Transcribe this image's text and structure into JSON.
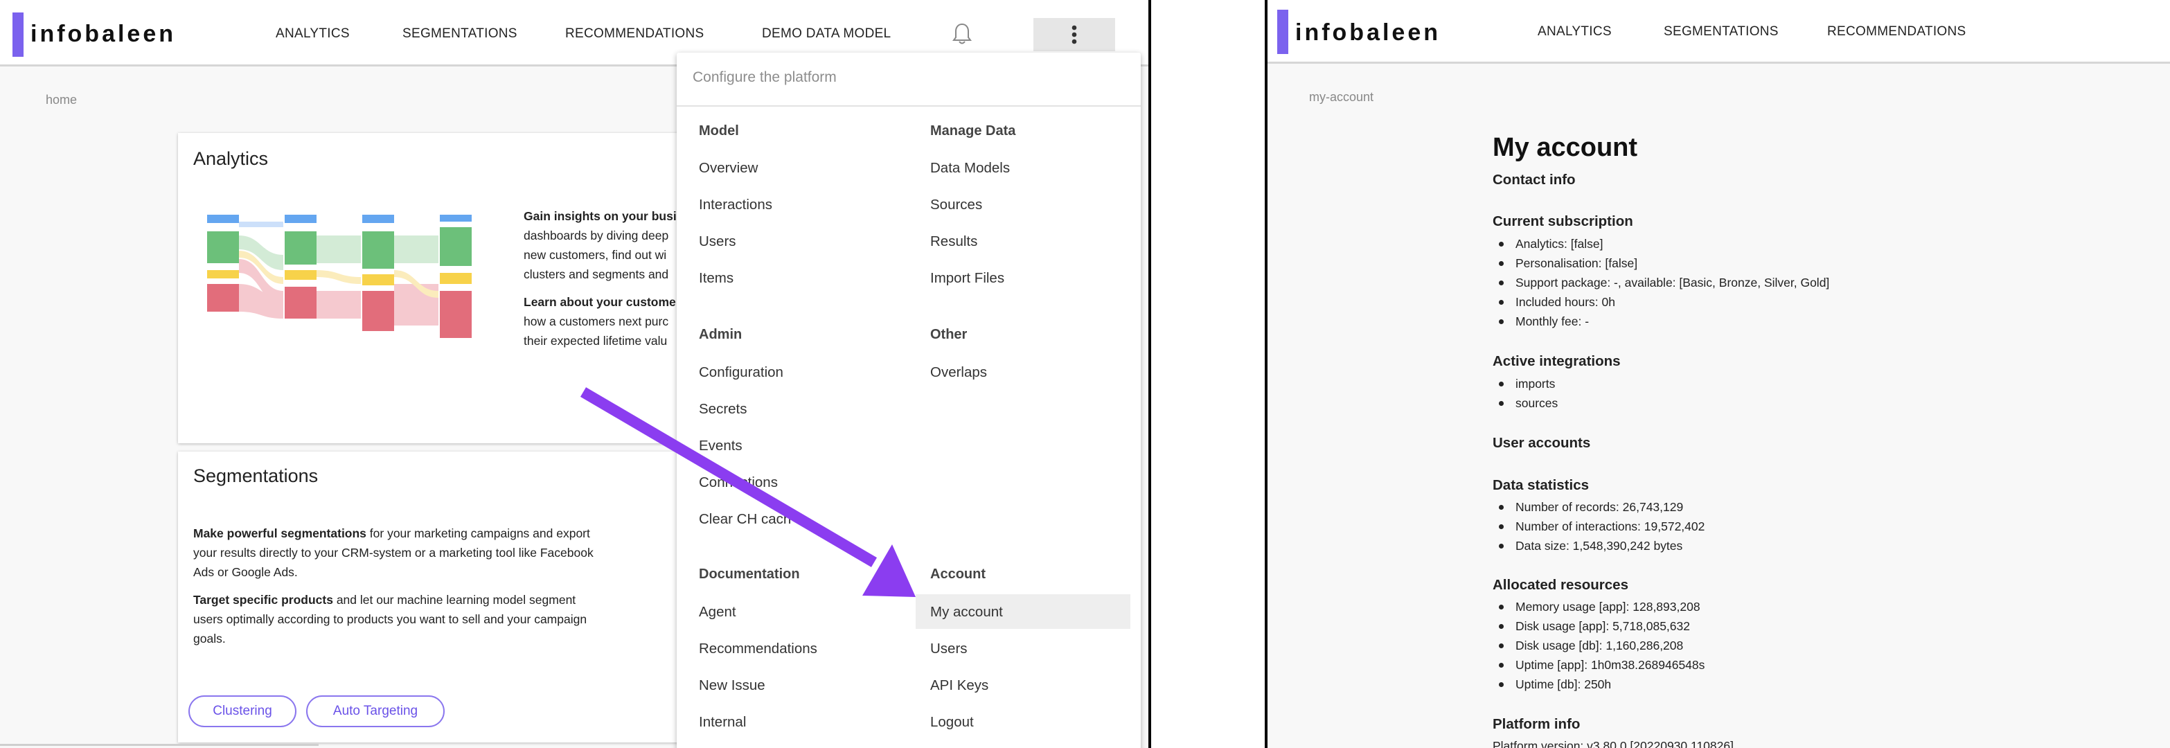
{
  "app": {
    "logo": "infobaleen",
    "accent": "#7b62ee"
  },
  "left": {
    "nav": [
      "ANALYTICS",
      "SEGMENTATIONS",
      "RECOMMENDATIONS",
      "DEMO DATA MODEL"
    ],
    "breadcrumb": "home",
    "analytics": {
      "title": "Analytics",
      "p1_bold": "Gain insights on your busi",
      "p1_lines": [
        "dashboards by diving deep",
        "new customers, find out wi",
        "clusters and segments and"
      ],
      "p2_bold": "Learn about your custome",
      "p2_lines": [
        "how a customers next purc",
        "their expected lifetime valu"
      ]
    },
    "segmentations": {
      "title": "Segmentations",
      "p1_bold": "Make powerful segmentations",
      "p1_rest": " for your marketing campaigns and export",
      "p1_lines": [
        "your results directly to your CRM-system or a marketing tool like Facebook",
        "Ads or Google Ads."
      ],
      "p2_bold": "Target specific products",
      "p2_rest": " and let our machine learning model segment",
      "p2_lines": [
        "users optimally according to products you want to sell and your campaign",
        "goals."
      ],
      "chips": [
        "Clustering",
        "Auto Targeting"
      ]
    },
    "menu": {
      "placeholder": "Configure the platform",
      "sections": {
        "model": {
          "title": "Model",
          "items": [
            "Overview",
            "Interactions",
            "Users",
            "Items"
          ]
        },
        "manage": {
          "title": "Manage Data",
          "items": [
            "Data Models",
            "Sources",
            "Results",
            "Import Files"
          ]
        },
        "admin": {
          "title": "Admin",
          "items": [
            "Configuration",
            "Secrets",
            "Events",
            "Connections",
            "Clear CH cach"
          ]
        },
        "other": {
          "title": "Other",
          "items": [
            "Overlaps"
          ]
        },
        "docs": {
          "title": "Documentation",
          "items": [
            "Agent",
            "Recommendations",
            "New Issue",
            "Internal"
          ]
        },
        "account": {
          "title": "Account",
          "items": [
            "My account",
            "Users",
            "API Keys",
            "Logout"
          ]
        }
      }
    },
    "arrow_color": "#8b3df0"
  },
  "right": {
    "nav": [
      "ANALYTICS",
      "SEGMENTATIONS",
      "RECOMMENDATIONS"
    ],
    "breadcrumb": "my-account",
    "title": "My account",
    "contact": "Contact info",
    "subscription": {
      "title": "Current subscription",
      "items": [
        "Analytics: [false]",
        "Personalisation: [false]",
        "Support package: -, available: [Basic, Bronze, Silver, Gold]",
        "Included hours: 0h",
        "Monthly fee: -"
      ]
    },
    "integrations": {
      "title": "Active integrations",
      "items": [
        "imports",
        "sources"
      ]
    },
    "user_accounts": "User accounts",
    "stats": {
      "title": "Data statistics",
      "items": [
        "Number of records: 26,743,129",
        "Number of interactions: 19,572,402",
        "Data size: 1,548,390,242 bytes"
      ]
    },
    "resources": {
      "title": "Allocated resources",
      "items": [
        "Memory usage [app]: 128,893,208",
        "Disk usage [app]: 5,718,085,632",
        "Disk usage [db]: 1,160,286,208",
        "Uptime [app]: 1h0m38.268946548s",
        "Uptime [db]: 250h"
      ]
    },
    "platform": {
      "title": "Platform info",
      "version": "Platform version: v3.80.0 [20220930.110826]"
    }
  }
}
